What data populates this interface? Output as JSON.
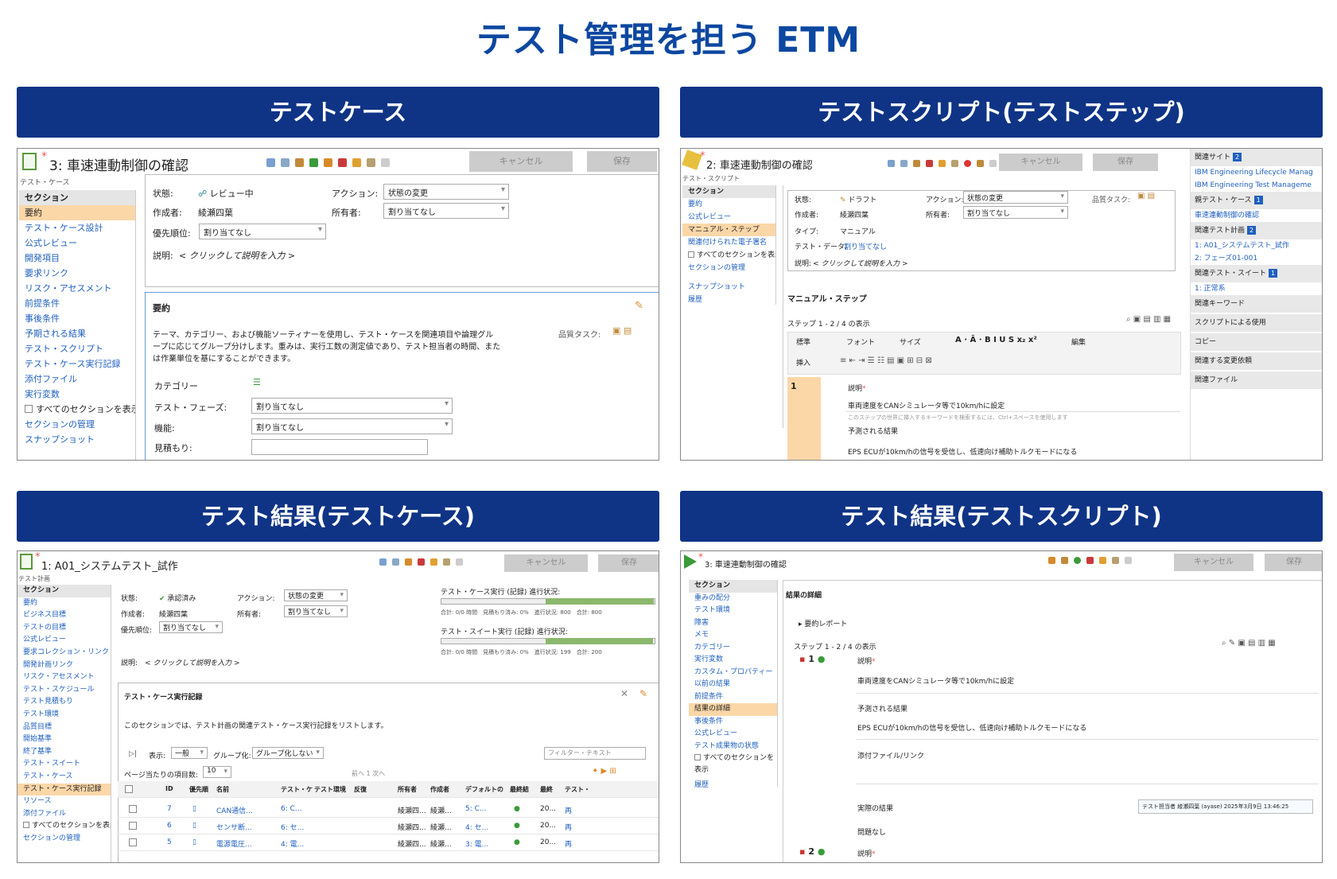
{
  "main_title": "テスト管理を担う ETM",
  "quadrant_titles": [
    "テストケース",
    "テストスクリプト(テストステップ)",
    "テスト結果(テストケース)",
    "テスト結果(テストスクリプト)"
  ],
  "buttons": {
    "cancel": "キャンセル",
    "save": "保存"
  },
  "q1": {
    "title": "3:  車速連動制御の確認",
    "type": "テスト・ケース",
    "side_header": "セクション",
    "side_items": [
      "要約",
      "テスト・ケース設計",
      "公式レビュー",
      "開発項目",
      "要求リンク",
      "リスク・アセスメント",
      "前提条件",
      "事後条件",
      "予期される結果",
      "テスト・スクリプト",
      "テスト・ケース実行記録",
      "添付ファイル",
      "実行変数"
    ],
    "show_all": "すべてのセクションを表示",
    "manage": "セクションの管理",
    "snapshot": "スナップショット",
    "state_label": "状態:",
    "state_value": "レビュー中",
    "action_label": "アクション:",
    "action_value": "状態の変更",
    "author_label": "作成者:",
    "author_value": "綾瀬四葉",
    "owner_label": "所有者:",
    "owner_value": "割り当てなし",
    "priority_label": "優先順位:",
    "priority_value": "割り当てなし",
    "desc_label": "説明:",
    "desc_value": "< クリックして説明を入力 >",
    "summary_title": "要約",
    "summary_text1": "テーマ、カテゴリー、および機能ソーティナーを使用し、テスト・ケースを関連項目や論理グル",
    "summary_text2": "ープに応じてグループ分けします。重みは、実行工数の測定値であり、テスト担当者の時間、また",
    "summary_text3": "は作業単位を基にすることができます。",
    "quality_task": "品質タスク:",
    "category_label": "カテゴリー",
    "phase_label": "テスト・フェーズ:",
    "phase_value": "割り当てなし",
    "function_label": "機能:",
    "function_value": "割り当てなし",
    "estimate_label": "見積もり:"
  },
  "q2": {
    "title": "2:  車速連動制御の確認",
    "type": "テスト・スクリプト",
    "side_header": "セクション",
    "side_items": [
      "要約",
      "公式レビュー",
      "マニュアル・ステップ",
      "関連付けられた電子署名"
    ],
    "show_all": "すべてのセクションを表示",
    "manage": "セクションの管理",
    "snapshot": "スナップショット",
    "history": "履歴",
    "state_label": "状態:",
    "state_value": "ドラフト",
    "action_label": "アクション:",
    "action_value": "状態の変更",
    "author_label": "作成者:",
    "author_value": "綾瀬四葉",
    "owner_label": "所有者:",
    "owner_value": "割り当てなし",
    "type_label": "タイプ:",
    "type_value": "マニュアル",
    "testdata_label": "テスト・データ:",
    "testdata_value": "割り当てなし",
    "desc_label": "説明:",
    "desc_value": "< クリックして説明を入力 >",
    "quality_task": "品質タスク:",
    "manual_steps": "マニュアル・ステップ",
    "steps_count": "ステップ 1 - 2 / 4 の表示",
    "editor": {
      "style": "標準",
      "font": "フォント",
      "size": "サイズ",
      "edit": "編集",
      "insert": "挿入"
    },
    "step_no": "1",
    "desc_hdr": "説明",
    "step_desc": "車両速度をCANシミュレータ等で10km/hに設定",
    "step_hint": "このステップの世界に挿入するキーワードを検索するには、Ctrl+スペースを使用します",
    "expected_hdr": "予測される結果",
    "expected_text": "EPS ECUが10km/hの信号を受信し、低速向け補助トルクモードになる",
    "right_panel": [
      {
        "label": "関連サイト",
        "badge": "2",
        "links": [
          "IBM Engineering Lifecycle Manag",
          "IBM Engineering Test Manageme"
        ]
      },
      {
        "label": "親テスト・ケース",
        "badge": "1",
        "links": [
          "車速連動制御の確認"
        ]
      },
      {
        "label": "関連テスト計画",
        "badge": "2",
        "links": [
          "1: A01_システムテスト_試作",
          "2: フェーズ01-001"
        ]
      },
      {
        "label": "関連テスト・スイート",
        "badge": "1",
        "links": [
          "1: 正常系"
        ]
      },
      {
        "label": "関連キーワード",
        "badge": "",
        "links": []
      },
      {
        "label": "スクリプトによる使用",
        "badge": "",
        "links": []
      },
      {
        "label": "コピー",
        "badge": "",
        "links": []
      },
      {
        "label": "関連する変更依頼",
        "badge": "",
        "links": []
      },
      {
        "label": "関連ファイル",
        "badge": "",
        "links": []
      }
    ]
  },
  "q3": {
    "title": "1:  A01_システムテスト_試作",
    "type": "テスト計画",
    "side_header": "セクション",
    "side_items": [
      "要約",
      "ビジネス目標",
      "テストの目標",
      "公式レビュー",
      "要求コレクション・リンク",
      "開発計画リンク",
      "リスク・アセスメント",
      "テスト・スケジュール",
      "テスト見積もり",
      "テスト環境",
      "品質目標",
      "開始基準",
      "終了基準",
      "テスト・スイート",
      "テスト・ケース",
      "テスト・ケース実行記録",
      "リソース",
      "添付ファイル"
    ],
    "show_all": "すべてのセクションを表示",
    "manage": "セクションの管理",
    "state_label": "状態:",
    "state_value": "承認済み",
    "action_label": "アクション:",
    "action_value": "状態の変更",
    "author_label": "作成者:",
    "author_value": "綾瀬四葉",
    "owner_label": "所有者:",
    "owner_value": "割り当てなし",
    "priority_label": "優先順位:",
    "priority_value": "割り当てなし",
    "desc_label": "説明:",
    "desc_value": "< クリックして説明を入力 >",
    "ter_progress": "テスト・ケース実行 (記録) 進行状況:",
    "ter_stats": [
      "合計: 0/0 時間",
      "見積もり済み: 0%",
      "進行状況: 800",
      "合計: 800"
    ],
    "tser_progress": "テスト・スイート実行 (記録) 進行状況:",
    "tser_stats": [
      "合計: 0/0 時間",
      "見積もり済み: 0%",
      "進行状況: 199",
      "合計: 200"
    ],
    "ter_fraction": 1.0,
    "tser_fraction": 0.995,
    "section_title": "テスト・ケース実行記録",
    "section_desc": "このセクションでは、テスト計画の関連テスト・ケース実行記録をリストします。",
    "view_label": "表示:",
    "view_value": "一般",
    "group_label": "グループ化:",
    "group_value": "グループ化しない",
    "filter_placeholder": "フィルター・テキスト",
    "per_page_label": "ページ当たりの項目数:",
    "per_page_value": "10",
    "pager": "前へ 1 次へ",
    "columns": [
      "ID",
      "優先順",
      "名前",
      "テスト・ケ",
      "テスト環境",
      "反復",
      "所有者",
      "作成者",
      "デフォルトの",
      "最終結",
      "最終",
      "テスト・"
    ],
    "rows": [
      {
        "id": "7",
        "name": "CAN通信...",
        "tc": "6: C...",
        "owner": "綾瀬四...",
        "creator": "綾瀬...",
        "default": "5: C...",
        "last": "20...",
        "test": "再"
      },
      {
        "id": "6",
        "name": "センサ断...",
        "tc": "6: セ...",
        "owner": "綾瀬四...",
        "creator": "綾瀬...",
        "default": "4: セ...",
        "last": "20...",
        "test": "再"
      },
      {
        "id": "5",
        "name": "電源電圧...",
        "tc": "4: 電...",
        "owner": "綾瀬四...",
        "creator": "綾瀬...",
        "default": "3: 電...",
        "last": "20...",
        "test": "再"
      }
    ]
  },
  "q4": {
    "title": "3:  車速連動制御の確認",
    "side_header": "セクション",
    "side_items": [
      "重みの配分",
      "テスト環境",
      "障害",
      "メモ",
      "カテゴリー",
      "実行変数",
      "カスタム・プロパティー",
      "以前の結果",
      "前提条件",
      "結果の詳細",
      "事後条件",
      "公式レビュー",
      "テスト成果物の状態"
    ],
    "show_all": "すべてのセクションを表示",
    "history": "履歴",
    "result_title": "結果の詳細",
    "summary_report": "要約レポート",
    "steps_count": "ステップ 1 - 2 / 4 の表示",
    "step1_no": "1",
    "desc_hdr": "説明",
    "step_desc": "車両速度をCANシミュレータ等で10km/hに設定",
    "expected_hdr": "予測される結果",
    "expected_text": "EPS ECUが10km/hの信号を受信し、低速向け補助トルクモードになる",
    "attach_hdr": "添付ファイル/リンク",
    "actual_hdr": "実際の結果",
    "tester": "テスト担当者 綾瀬四葉 (ayase) 2025年3月9日 13:46:25",
    "actual_text": "問題なし",
    "step2_no": "2"
  },
  "colors": {
    "header_blue": "#0f3486",
    "title_blue": "#0c47a0",
    "link": "#1f5fbf",
    "active_section": "#fbd7a8",
    "pass_green": "#3a9b3a"
  }
}
